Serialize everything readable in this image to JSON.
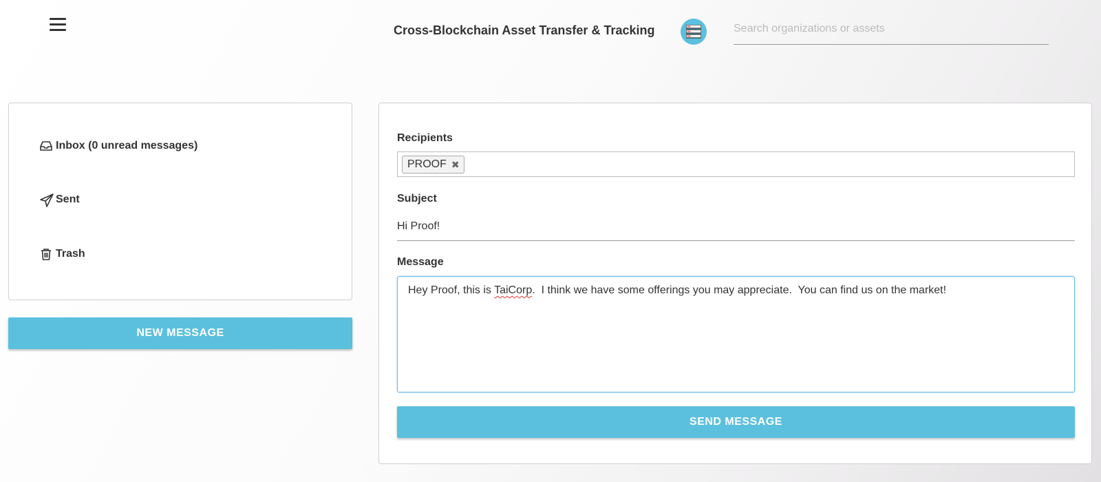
{
  "header": {
    "title": "Cross-Blockchain Asset Transfer & Tracking",
    "logo_icon": "server-stack-icon",
    "search_placeholder": "Search organizations or assets"
  },
  "sidebar": {
    "items": [
      {
        "label": "Inbox (0 unread messages)",
        "icon": "inbox-icon"
      },
      {
        "label": "Sent",
        "icon": "paper-plane-icon"
      },
      {
        "label": "Trash",
        "icon": "trash-icon"
      }
    ],
    "new_message_label": "NEW MESSAGE"
  },
  "compose": {
    "recipients_label": "Recipients",
    "recipients": [
      "PROOF"
    ],
    "remove_icon": "close-icon",
    "subject_label": "Subject",
    "subject_value": "Hi Proof!",
    "message_label": "Message",
    "message_part1": "Hey Proof, this is ",
    "message_misspelled": "TaiCorp",
    "message_part2": ".  I think we have some offerings you may appreciate.  You can find us on the market!",
    "send_label": "SEND MESSAGE"
  },
  "colors": {
    "accent": "#5bc0de",
    "focus_border": "#66b7e8"
  }
}
